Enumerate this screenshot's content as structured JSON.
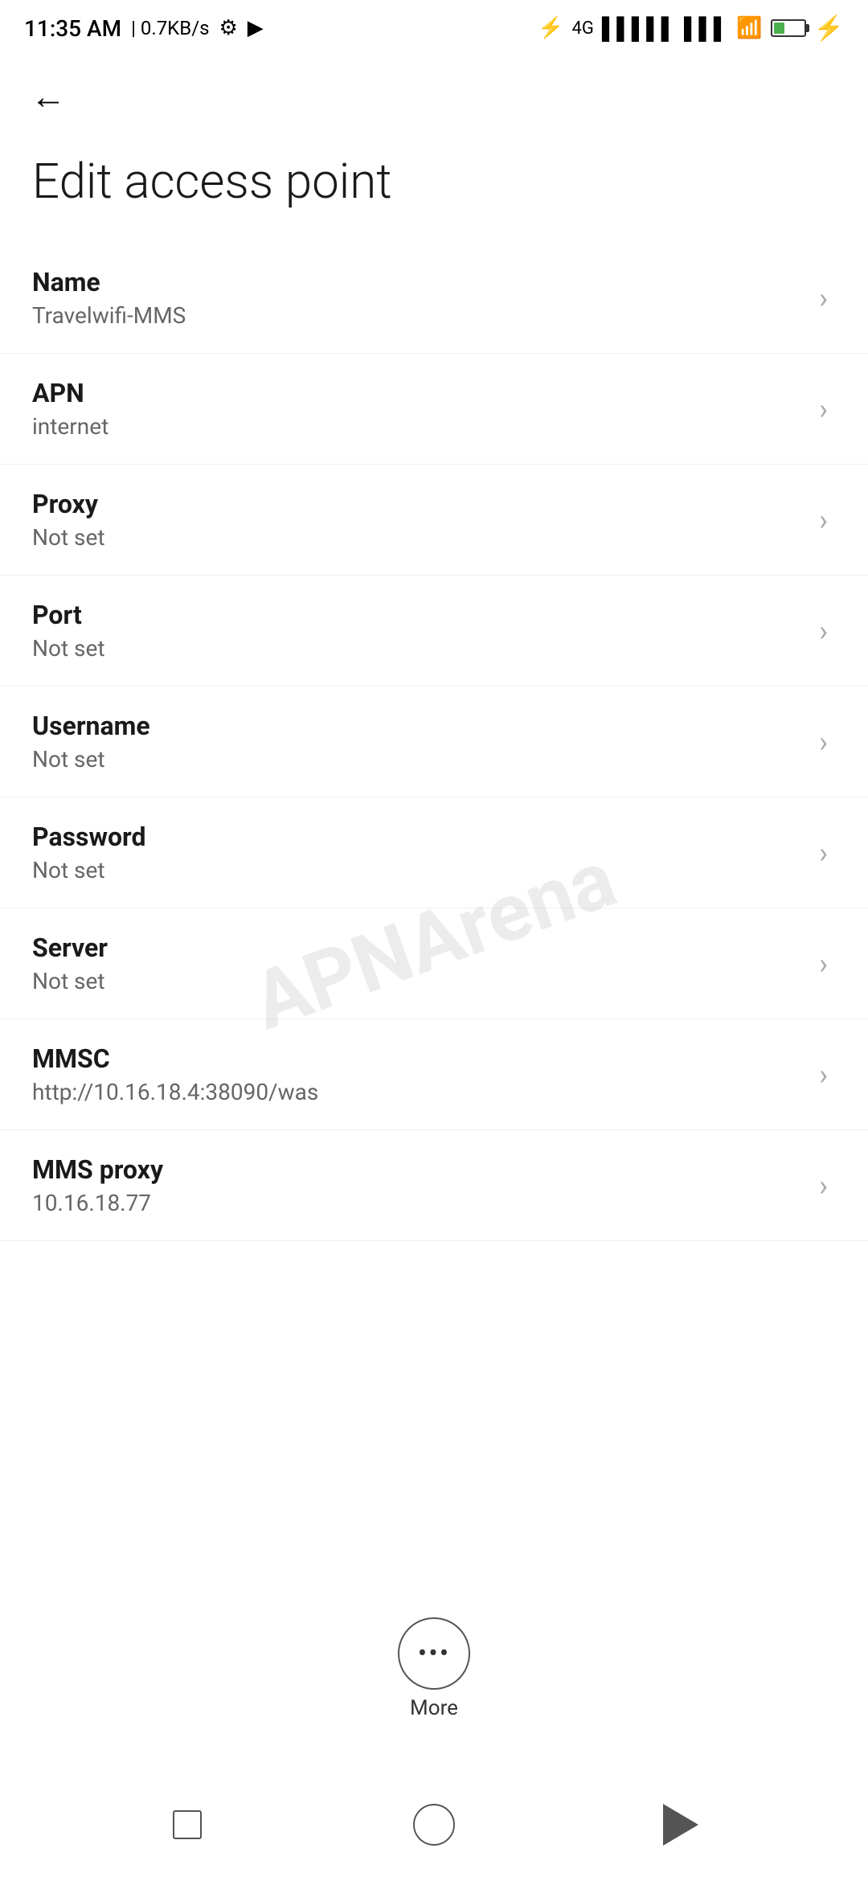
{
  "statusBar": {
    "time": "11:35 AM",
    "speed": "| 0.7KB/s",
    "battery": "38"
  },
  "header": {
    "backLabel": "←",
    "title": "Edit access point"
  },
  "settings": [
    {
      "label": "Name",
      "value": "Travelwifi-MMS"
    },
    {
      "label": "APN",
      "value": "internet"
    },
    {
      "label": "Proxy",
      "value": "Not set"
    },
    {
      "label": "Port",
      "value": "Not set"
    },
    {
      "label": "Username",
      "value": "Not set"
    },
    {
      "label": "Password",
      "value": "Not set"
    },
    {
      "label": "Server",
      "value": "Not set"
    },
    {
      "label": "MMSC",
      "value": "http://10.16.18.4:38090/was"
    },
    {
      "label": "MMS proxy",
      "value": "10.16.18.77"
    }
  ],
  "more": {
    "label": "More"
  },
  "watermark": {
    "text": "APNArena"
  }
}
